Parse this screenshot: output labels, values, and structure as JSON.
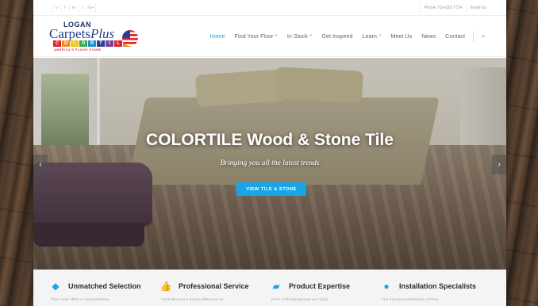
{
  "topbar": {
    "social": [
      "v",
      "f",
      "in",
      "t",
      "G+"
    ],
    "phone": "Phone 719-633-7724",
    "email": "Email Us"
  },
  "logo": {
    "line1": "LOGAN",
    "line2a": "Carpets",
    "line2b": "Plus",
    "colortile": [
      "C",
      "O",
      "L",
      "O",
      "R",
      "T",
      "I",
      "L",
      "E"
    ],
    "colortile_colors": [
      "#d8262e",
      "#f08a1c",
      "#f3c419",
      "#3aa54a",
      "#1a8fd6",
      "#2b3f8f",
      "#7b3f9c",
      "#d8262e",
      "#f08a1c"
    ],
    "tagline": "AMERICA'S FLOOR STORE"
  },
  "nav": {
    "items": [
      {
        "label": "Home",
        "dropdown": false,
        "active": true
      },
      {
        "label": "Find Your Floor",
        "dropdown": true,
        "active": false
      },
      {
        "label": "In Stock",
        "dropdown": true,
        "active": false
      },
      {
        "label": "Get Inspired",
        "dropdown": false,
        "active": false
      },
      {
        "label": "Learn",
        "dropdown": true,
        "active": false
      },
      {
        "label": "Meet Us",
        "dropdown": false,
        "active": false
      },
      {
        "label": "News",
        "dropdown": false,
        "active": false
      },
      {
        "label": "Contact",
        "dropdown": false,
        "active": false
      }
    ],
    "chevron": "˅",
    "search_icon": "⌕"
  },
  "hero": {
    "title": "COLORTILE Wood & Stone Tile",
    "subtitle": "Bringing you all the latest trends",
    "cta": "VIEW TILE & STONE",
    "prev": "‹",
    "next": "›"
  },
  "features": [
    {
      "icon": "tag-icon",
      "glyph": "◆",
      "title": "Unmatched Selection",
      "desc": "Floor Craft offers a comprehensive"
    },
    {
      "icon": "thumbs-up-icon",
      "glyph": "👍",
      "title": "Professional Service",
      "desc": "You'll discover a unique difference at"
    },
    {
      "icon": "book-icon",
      "glyph": "▰",
      "title": "Product Expertise",
      "desc": "Floor Craft salespeople are highly"
    },
    {
      "icon": "user-icon",
      "glyph": "●",
      "title": "Installation Specialists",
      "desc": "The trained professionals at Floor"
    }
  ],
  "colors": {
    "accent": "#1aa6e6",
    "nav_text": "#666666"
  }
}
